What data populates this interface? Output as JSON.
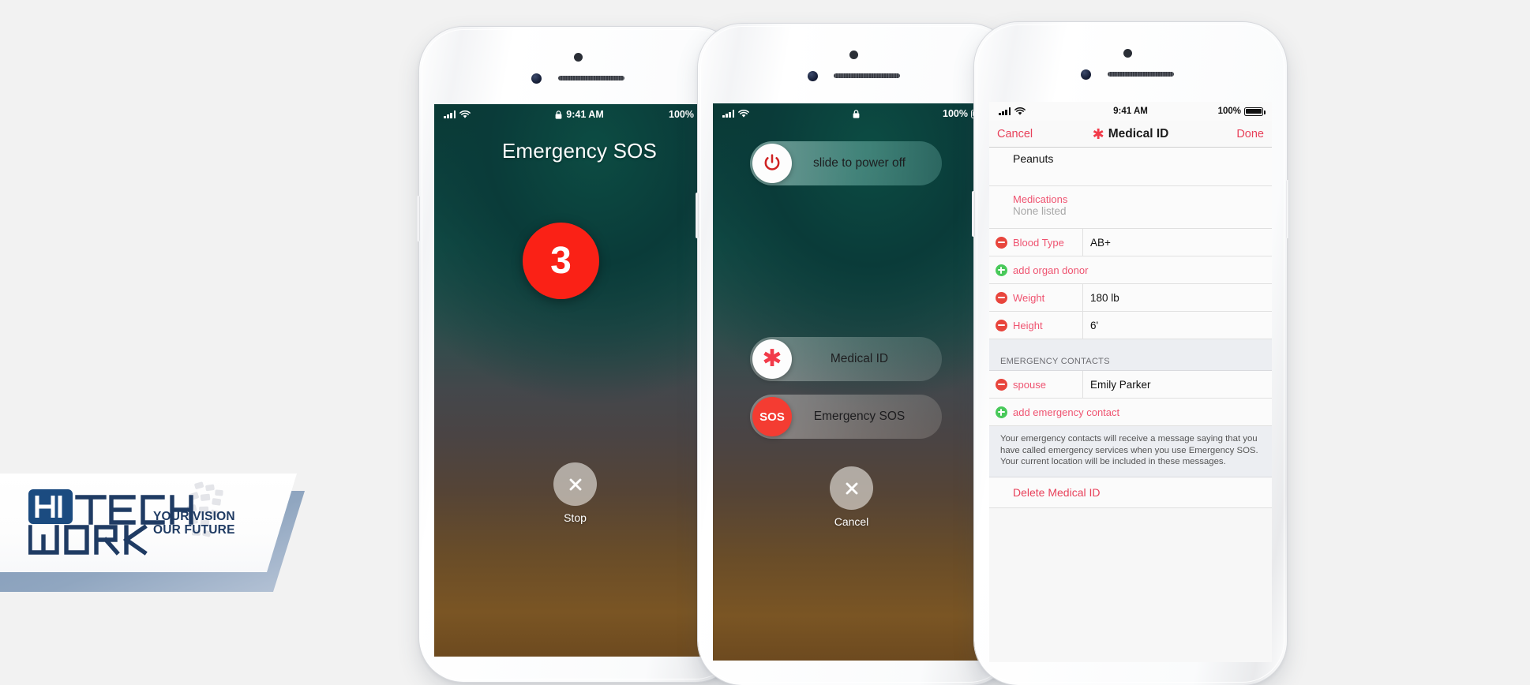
{
  "background_color": "#f2f2f2",
  "brand": {
    "name_part1": "HI",
    "name_part2": "TECH",
    "name_part3": "WORK",
    "tagline_line1": "YOUR VISION",
    "tagline_line2": "OUR FUTURE",
    "primary_color": "#1f3b63",
    "accent_color": "#7e97b6"
  },
  "phone1": {
    "status": {
      "time": "9:41 AM",
      "battery": "100%",
      "lock_icon": "lock-icon",
      "signal_icon": "signal-bars-icon",
      "wifi_icon": "wifi-icon"
    },
    "title": "Emergency SOS",
    "countdown": "3",
    "stop_label": "Stop",
    "stop_icon": "close-x-icon"
  },
  "phone2": {
    "status": {
      "battery": "100%",
      "lock_icon": "lock-icon",
      "signal_icon": "signal-bars-icon",
      "wifi_icon": "wifi-icon"
    },
    "sliders": [
      {
        "label": "slide to power off",
        "icon": "power-icon"
      },
      {
        "label": "Medical ID",
        "icon": "medical-asterisk-icon"
      },
      {
        "label": "Emergency SOS",
        "icon": "sos-icon",
        "icon_text": "SOS"
      }
    ],
    "cancel_label": "Cancel",
    "cancel_icon": "close-x-icon"
  },
  "phone3": {
    "status": {
      "time": "9:41 AM",
      "battery": "100%",
      "signal_icon": "signal-bars-icon",
      "wifi_icon": "wifi-icon"
    },
    "nav": {
      "left": "Cancel",
      "title": "Medical ID",
      "right": "Done",
      "title_icon": "medical-asterisk-icon"
    },
    "allergy_value": "Peanuts",
    "medications": {
      "label": "Medications",
      "value": "None listed"
    },
    "fields": [
      {
        "icon": "minus-icon",
        "label": "Blood Type",
        "value": "AB+"
      },
      {
        "icon": "plus-icon",
        "label": "add organ donor",
        "value": ""
      },
      {
        "icon": "minus-icon",
        "label": "Weight",
        "value": "180 lb"
      },
      {
        "icon": "minus-icon",
        "label": "Height",
        "value": "6'"
      }
    ],
    "contacts_header": "EMERGENCY CONTACTS",
    "contacts": [
      {
        "icon": "minus-icon",
        "label": "spouse",
        "value": "Emily Parker"
      },
      {
        "icon": "plus-icon",
        "label": "add emergency contact",
        "value": ""
      }
    ],
    "note": "Your emergency contacts will receive a message saying that you have called emergency services when you use Emergency SOS. Your current location will be included in these messages.",
    "delete_label": "Delete Medical ID"
  }
}
